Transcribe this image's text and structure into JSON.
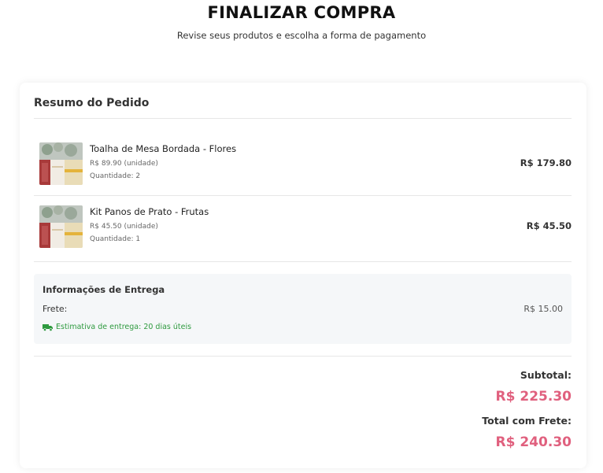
{
  "header": {
    "title": "FINALIZAR COMPRA",
    "subtitle": "Revise seus produtos e escolha a forma de pagamento"
  },
  "summary": {
    "title": "Resumo do Pedido",
    "items": [
      {
        "name": "Toalha de Mesa Bordada - Flores",
        "unit_price": "R$ 89.90 (unidade)",
        "quantity": "Quantidade: 2",
        "total": "R$ 179.80"
      },
      {
        "name": "Kit Panos de Prato - Frutas",
        "unit_price": "R$ 45.50 (unidade)",
        "quantity": "Quantidade: 1",
        "total": "R$ 45.50"
      }
    ]
  },
  "delivery": {
    "title": "Informações de Entrega",
    "freight_label": "Frete:",
    "freight_value": "R$ 15.00",
    "estimate": "Estimativa de entrega: 20 dias úteis",
    "icon": "truck-icon"
  },
  "totals": {
    "subtotal_label": "Subtotal:",
    "subtotal_value": "R$ 225.30",
    "total_label": "Total com Frete:",
    "total_value": "R$ 240.30"
  },
  "colors": {
    "accent": "#e0607e",
    "success": "#2e9a3f",
    "panel": "#f5f7f9"
  }
}
